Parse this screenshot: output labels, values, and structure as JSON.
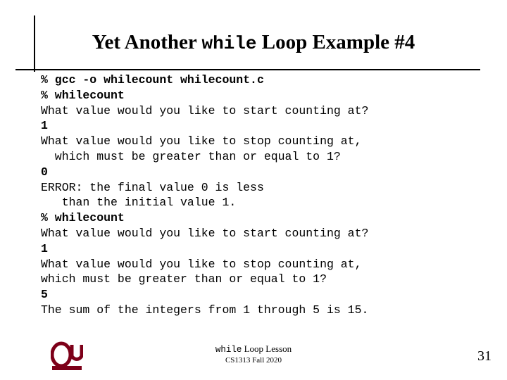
{
  "slide": {
    "title": {
      "part1": "Yet Another ",
      "keyword": "while",
      "part2": " Loop Example #4"
    },
    "console_lines": [
      {
        "text": "% gcc -o whilecount whilecount.c",
        "bold": true
      },
      {
        "text": "% whilecount",
        "bold": true
      },
      {
        "text": "What value would you like to start counting at?",
        "bold": false
      },
      {
        "text": "1",
        "bold": true
      },
      {
        "text": "What value would you like to stop counting at,",
        "bold": false
      },
      {
        "text": "  which must be greater than or equal to 1?",
        "bold": false
      },
      {
        "text": "0",
        "bold": true
      },
      {
        "text": "ERROR: the final value 0 is less",
        "bold": false
      },
      {
        "text": "   than the initial value 1.",
        "bold": false
      },
      {
        "text": "% whilecount",
        "bold": true
      },
      {
        "text": "What value would you like to start counting at?",
        "bold": false
      },
      {
        "text": "1",
        "bold": true
      },
      {
        "text": "What value would you like to stop counting at,",
        "bold": false
      },
      {
        "text": "which must be greater than or equal to 1?",
        "bold": false
      },
      {
        "text": "5",
        "bold": true
      },
      {
        "text": "The sum of the integers from 1 through 5 is 15.",
        "bold": false
      }
    ],
    "footer": {
      "lesson_prefix": "while",
      "lesson_suffix": " Loop Lesson",
      "course": "CS1313 Fall 2020",
      "page_number": "31"
    },
    "logo": {
      "label": "OU",
      "color": "#7D0019"
    }
  }
}
